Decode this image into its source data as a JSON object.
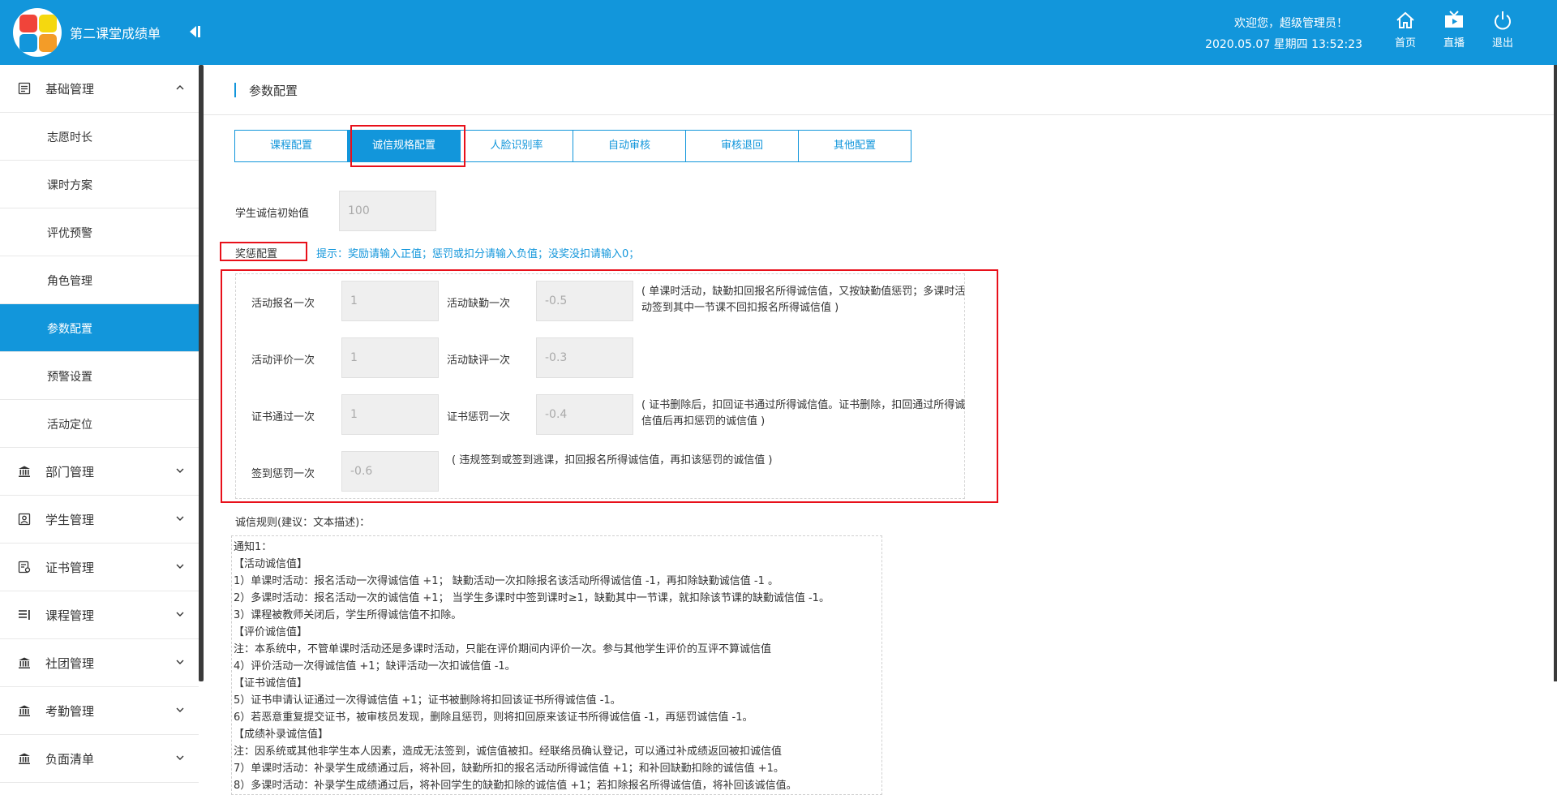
{
  "header": {
    "app_title": "第二课堂成绩单",
    "welcome": "欢迎您，超级管理员！",
    "datetime": "2020.05.07 星期四 13:52:23",
    "buttons": [
      {
        "label": "首页",
        "icon": "home-icon"
      },
      {
        "label": "直播",
        "icon": "live-icon"
      },
      {
        "label": "退出",
        "icon": "power-icon"
      }
    ],
    "colors": {
      "primary": "#1296db",
      "highlight": "#e8101a"
    }
  },
  "sidebar": {
    "groups": [
      {
        "label": "基础管理",
        "icon": "list-icon",
        "expanded": true,
        "items": [
          {
            "label": "志愿时长"
          },
          {
            "label": "课时方案"
          },
          {
            "label": "评优预警"
          },
          {
            "label": "角色管理"
          },
          {
            "label": "参数配置",
            "active": true
          },
          {
            "label": "预警设置"
          },
          {
            "label": "活动定位"
          }
        ]
      },
      {
        "label": "部门管理",
        "icon": "bank-icon"
      },
      {
        "label": "学生管理",
        "icon": "student-icon"
      },
      {
        "label": "证书管理",
        "icon": "certificate-icon"
      },
      {
        "label": "课程管理",
        "icon": "course-icon"
      },
      {
        "label": "社团管理",
        "icon": "bank-icon"
      },
      {
        "label": "考勤管理",
        "icon": "bank-icon"
      },
      {
        "label": "负面清单",
        "icon": "bank-icon"
      }
    ]
  },
  "page": {
    "title": "参数配置",
    "tabs": [
      {
        "label": "课程配置"
      },
      {
        "label": "诚信规格配置",
        "active": true
      },
      {
        "label": "人脸识别率"
      },
      {
        "label": "自动审核"
      },
      {
        "label": "审核退回"
      },
      {
        "label": "其他配置"
      }
    ],
    "initial_value": {
      "label": "学生诚信初始值",
      "value": "100"
    },
    "reward_section": {
      "label": "奖惩配置",
      "hint": "提示：奖励请输入正值；惩罚或扣分请输入负值；没奖没扣请输入0；"
    },
    "fields": {
      "signup": {
        "label": "活动报名一次",
        "value": "1"
      },
      "absent": {
        "label": "活动缺勤一次",
        "value": "-0.5"
      },
      "absent_note": "( 单课时活动，缺勤扣回报名所得诚信值，又按缺勤值惩罚；多课时活动签到其中一节课不回扣报名所得诚信值 )",
      "evaluate": {
        "label": "活动评价一次",
        "value": "1"
      },
      "missing_eval": {
        "label": "活动缺评一次",
        "value": "-0.3"
      },
      "cert_pass": {
        "label": "证书通过一次",
        "value": "1"
      },
      "cert_penalty": {
        "label": "证书惩罚一次",
        "value": "-0.4"
      },
      "cert_note": "( 证书删除后，扣回证书通过所得诚信值。证书删除，扣回通过所得诚信值后再扣惩罚的诚信值 )",
      "checkin_penalty": {
        "label": "签到惩罚一次",
        "value": "-0.6"
      },
      "checkin_note": "( 违规签到或签到逃课，扣回报名所得诚信值，再扣该惩罚的诚信值 )"
    },
    "rules": {
      "label": "诚信规则(建议：文本描述)：",
      "lines": [
        "通知1：",
        "【活动诚信值】",
        "1）单课时活动：报名活动一次得诚信值 +1； 缺勤活动一次扣除报名该活动所得诚信值 -1，再扣除缺勤诚信值 -1 。",
        "2）多课时活动：报名活动一次的诚信值 +1； 当学生多课时中签到课时≥1，缺勤其中一节课，就扣除该节课的缺勤诚信值 -1。",
        "3）课程被教师关闭后，学生所得诚信值不扣除。",
        "【评价诚信值】",
        "注：本系统中，不管单课时活动还是多课时活动，只能在评价期间内评价一次。参与其他学生评价的互评不算诚信值",
        "4）评价活动一次得诚信值 +1；缺评活动一次扣诚信值 -1。",
        "【证书诚信值】",
        "5）证书申请认证通过一次得诚信值 +1；证书被删除将扣回该证书所得诚信值 -1。",
        "6）若恶意重复提交证书，被审核员发现，删除且惩罚，则将扣回原来该证书所得诚信值 -1，再惩罚诚信值 -1。",
        "【成绩补录诚信值】",
        "注：因系统或其他非学生本人因素，造成无法签到，诚信值被扣。经联络员确认登记，可以通过补成绩返回被扣诚信值",
        "7）单课时活动：补录学生成绩通过后，将补回，缺勤所扣的报名活动所得诚信值 +1；和补回缺勤扣除的诚信值 +1。",
        "8）多课时活动：补录学生成绩通过后，将补回学生的缺勤扣除的诚信值 +1；若扣除报名所得诚信值，将补回该诚信值。"
      ]
    }
  }
}
